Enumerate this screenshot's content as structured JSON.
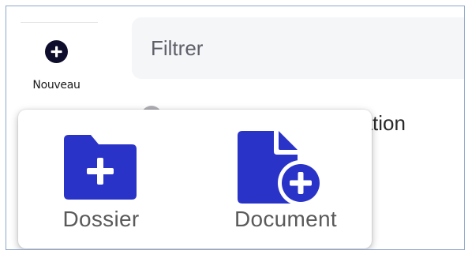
{
  "toolbar": {
    "new_label": "Nouveau",
    "new_icon": "plus-circle-icon"
  },
  "filter": {
    "placeholder": "Filtrer"
  },
  "background": {
    "partial_text": "paration"
  },
  "popup": {
    "options": [
      {
        "label": "Dossier",
        "icon": "folder-plus-icon"
      },
      {
        "label": "Document",
        "icon": "document-plus-icon"
      }
    ]
  },
  "colors": {
    "accent": "#2a33c8",
    "new_button": "#0e0e2c",
    "frame_border": "#8fa6c8"
  }
}
